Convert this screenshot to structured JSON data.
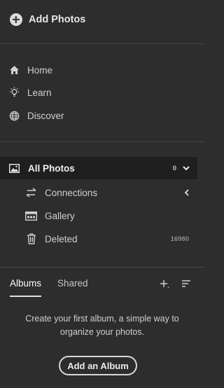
{
  "header": {
    "add_photos_label": "Add Photos",
    "add_photos_icon": "plus-circle-icon"
  },
  "nav": [
    {
      "label": "Home",
      "icon": "home-icon"
    },
    {
      "label": "Learn",
      "icon": "lightbulb-icon"
    },
    {
      "label": "Discover",
      "icon": "globe-icon"
    }
  ],
  "library": {
    "all_photos": {
      "label": "All Photos",
      "count": "0",
      "icon": "image-icon",
      "toggle_icon": "chevron-down-icon"
    },
    "items": [
      {
        "label": "Connections",
        "icon": "connections-icon",
        "trail_icon": "chevron-left-icon"
      },
      {
        "label": "Gallery",
        "icon": "gallery-icon"
      },
      {
        "label": "Deleted",
        "icon": "trash-icon",
        "count": "16980"
      }
    ]
  },
  "albums": {
    "tabs": [
      {
        "label": "Albums",
        "active": true
      },
      {
        "label": "Shared",
        "active": false
      }
    ],
    "add_icon": "plus-icon",
    "sort_icon": "sort-icon",
    "empty_message": "Create your first album, a simple way to organize your photos.",
    "add_album_label": "Add an Album"
  },
  "colors": {
    "background": "#2d2d2d",
    "selected_row": "#1f1f1f",
    "divider": "#454545",
    "text": "#cfcfcf"
  }
}
